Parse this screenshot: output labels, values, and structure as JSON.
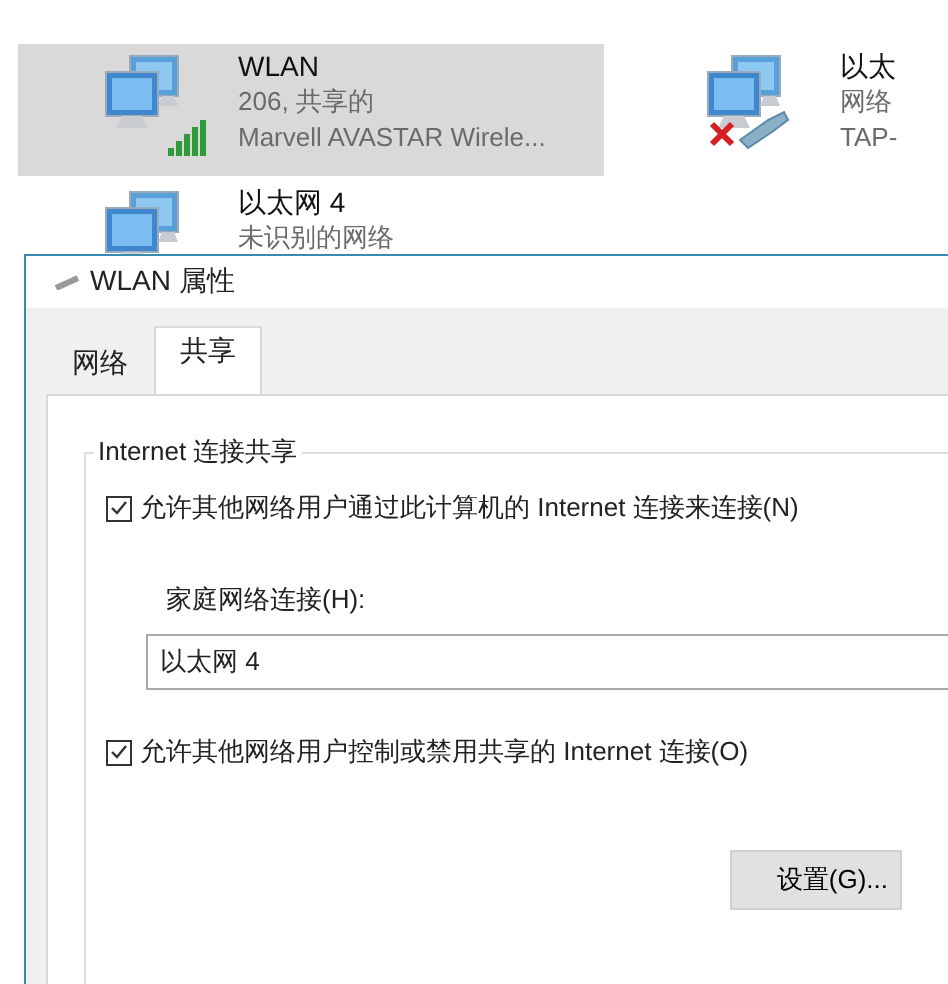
{
  "connections": [
    {
      "name": "WLAN",
      "status": "206, 共享的",
      "device": "Marvell AVASTAR Wirele...",
      "selected": true,
      "kind": "wireless"
    },
    {
      "name": "以太",
      "status": "网络",
      "device": "TAP-",
      "selected": false,
      "kind": "unplugged"
    },
    {
      "name": "以太网 4",
      "status": "未识别的网络",
      "selected": false,
      "kind": "plain"
    }
  ],
  "dialog": {
    "title": "WLAN 属性",
    "tabs": [
      {
        "label": "网络",
        "selected": false
      },
      {
        "label": "共享",
        "selected": true
      }
    ],
    "group_title": "Internet 连接共享",
    "allow_share": {
      "label": "允许其他网络用户通过此计算机的 Internet 连接来连接(N)",
      "checked": true
    },
    "home_label": "家庭网络连接(H):",
    "home_value": "以太网 4",
    "allow_control": {
      "label": "允许其他网络用户控制或禁用共享的 Internet 连接(O)",
      "checked": true
    },
    "settings_button": "设置(G)..."
  }
}
